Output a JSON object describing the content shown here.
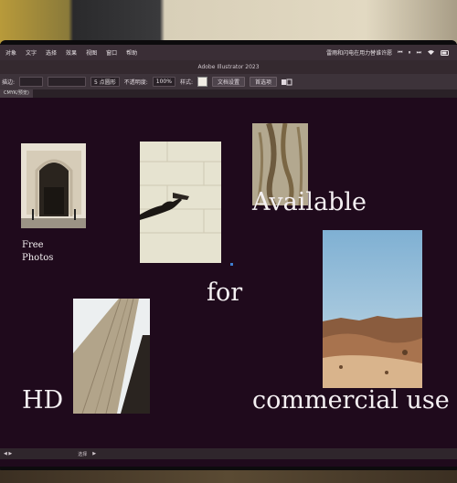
{
  "menubar": {
    "items": [
      "对象",
      "文字",
      "选择",
      "效果",
      "视图",
      "窗口",
      "帮助"
    ],
    "now_playing": "雷雨和闪电在用力替谁许愿",
    "media_controls": [
      "⏮",
      "⏸",
      "⏭"
    ]
  },
  "titlebar": {
    "title": "Adobe Illustrator 2023"
  },
  "controlbar": {
    "stroke_label": "描边:",
    "brush": "5 点圆形",
    "opacity_label": "不透明度:",
    "opacity_value": "100%",
    "style_label": "样式:",
    "doc_setup": "文档设置",
    "preferences": "首选项"
  },
  "doctab": {
    "label": "CMYK/预览)"
  },
  "canvas": {
    "free_photos": "Free\nPhotos",
    "available": "Available",
    "for": "for",
    "hd": "HD",
    "commercial_use": "commercial use"
  },
  "statusbar": {
    "tool": "选择"
  },
  "colors": {
    "canvas_bg": "#1f0a1c",
    "menubar_bg": "#3a2e36",
    "text": "#f4f0f2"
  }
}
